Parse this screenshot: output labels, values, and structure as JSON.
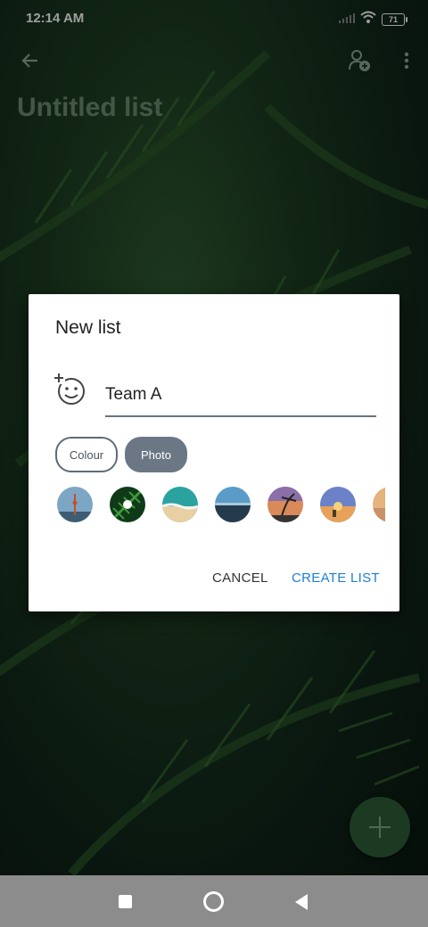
{
  "status_bar": {
    "time": "12:14 AM",
    "battery": "71"
  },
  "list_title": "Untitled list",
  "dialog": {
    "title": "New list",
    "name_value": "Team A",
    "chips": [
      "Colour",
      "Photo"
    ],
    "selected_chip": "Photo",
    "photo_thumbnails": [
      "city-tower-icon",
      "fern-icon",
      "beach-wave-icon",
      "ocean-horizon-icon",
      "palm-sunset-icon",
      "desert-sunset-icon",
      "shore-sunset-icon"
    ],
    "cancel_label": "CANCEL",
    "create_label": "CREATE LIST"
  },
  "colors": {
    "accent": "#1e7fd6",
    "chip_selected": "#6b7785",
    "navbar": "#8c8c8c"
  }
}
